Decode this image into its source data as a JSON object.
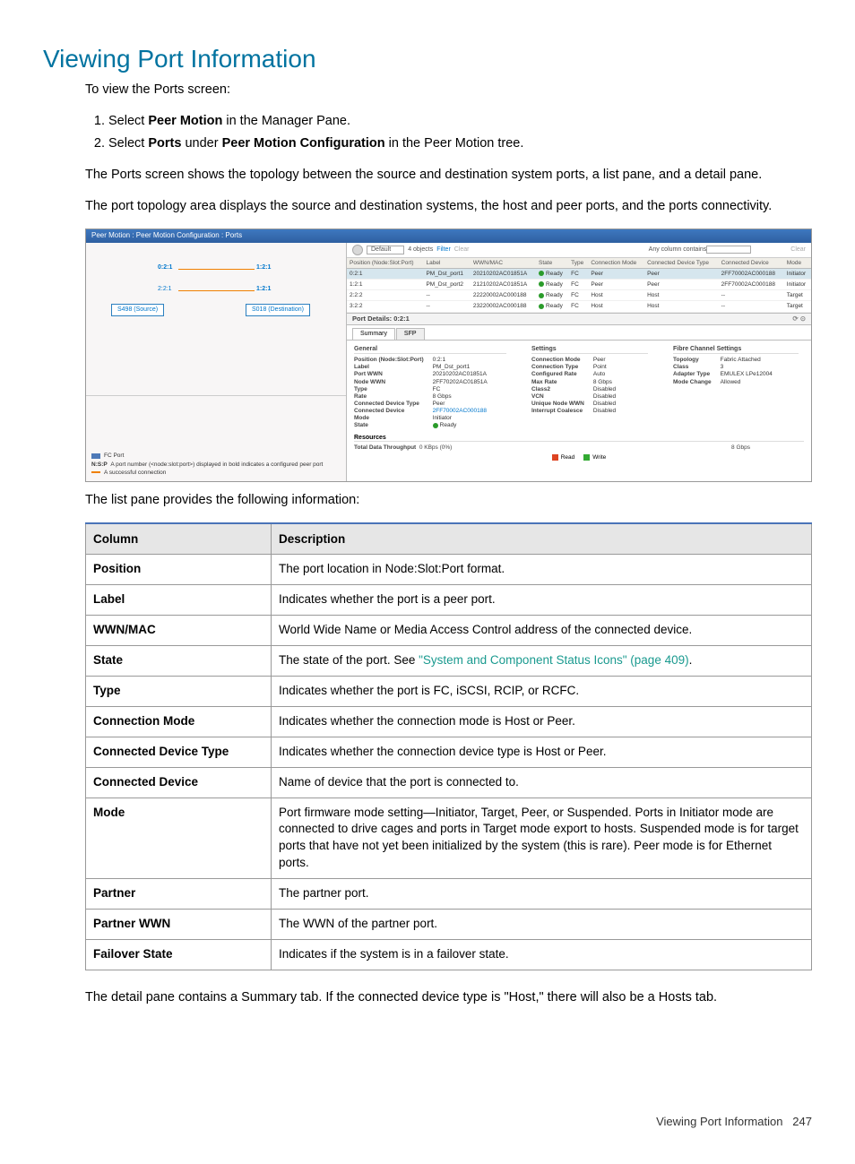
{
  "title": "Viewing Port Information",
  "intro": "To view the Ports screen:",
  "step1_a": "Select ",
  "step1_b": "Peer Motion",
  "step1_c": " in the Manager Pane.",
  "step2_a": "Select ",
  "step2_b": "Ports",
  "step2_c": " under ",
  "step2_d": "Peer Motion Configuration",
  "step2_e": " in the Peer Motion tree.",
  "para1": "The Ports screen shows the topology between the source and destination system ports, a list pane, and a detail pane.",
  "para2": "The port topology area displays the source and destination systems, the host and peer ports, and the ports connectivity.",
  "para3": "The list pane provides the following information:",
  "para4": "The detail pane contains a Summary tab. If the connected device type is \"Host,\" there will also be a Hosts tab.",
  "screenshot": {
    "title": "Peer Motion : Peer Motion Configuration : Ports",
    "topo": {
      "p1": "0:2:1",
      "p2": "1:2:1",
      "p3": "2:2:1",
      "p4": "1:2:1",
      "src": "S498 (Source)",
      "dst": "S018 (Destination)"
    },
    "legend": {
      "l1": "FC Port",
      "l2_a": "N:S:P",
      "l2_b": "A port number (<node:slot:port>) displayed in bold indicates a configured peer port",
      "l3": "A successful connection"
    },
    "toolbar": {
      "default": "Default",
      "objects": "4 objects",
      "filter": "Filter",
      "clear": "Clear",
      "any": "Any column contains",
      "clearbtn": "Clear"
    },
    "headers": [
      "Position (Node:Slot:Port)",
      "Label",
      "WWN/MAC",
      "State",
      "Type",
      "Connection Mode",
      "Connected Device Type",
      "Connected Device",
      "Mode"
    ],
    "rows": [
      {
        "pos": "0:2:1",
        "label": "PM_Dst_port1",
        "wwn": "20210202AC01851A",
        "state": "Ready",
        "type": "FC",
        "cm": "Peer",
        "cdt": "Peer",
        "cd": "2FF70002AC000188",
        "mode": "Initiator",
        "sel": true
      },
      {
        "pos": "1:2:1",
        "label": "PM_Dst_port2",
        "wwn": "21210202AC01851A",
        "state": "Ready",
        "type": "FC",
        "cm": "Peer",
        "cdt": "Peer",
        "cd": "2FF70002AC000188",
        "mode": "Initiator"
      },
      {
        "pos": "2:2:2",
        "label": "--",
        "wwn": "22220002AC000188",
        "state": "Ready",
        "type": "FC",
        "cm": "Host",
        "cdt": "Host",
        "cd": "--",
        "mode": "Target"
      },
      {
        "pos": "3:2:2",
        "label": "--",
        "wwn": "23220002AC000188",
        "state": "Ready",
        "type": "FC",
        "cm": "Host",
        "cdt": "Host",
        "cd": "--",
        "mode": "Target"
      }
    ],
    "detailTitle": "Port Details: 0:2:1",
    "tabs": {
      "summary": "Summary",
      "sfp": "SFP"
    },
    "detail": {
      "general": {
        "title": "General",
        "kv": [
          [
            "Position (Node:Slot:Port)",
            "0:2:1"
          ],
          [
            "Label",
            "PM_Dst_port1"
          ],
          [
            "Port WWN",
            "20210202AC01851A"
          ],
          [
            "Node WWN",
            "2FF70202AC01851A"
          ],
          [
            "Type",
            "FC"
          ],
          [
            "Rate",
            "8 Gbps"
          ],
          [
            "Connected Device Type",
            "Peer"
          ],
          [
            "Connected Device",
            "2FF70002AC000188"
          ],
          [
            "Mode",
            "Initiator"
          ],
          [
            "State",
            "Ready"
          ]
        ]
      },
      "settings": {
        "title": "Settings",
        "kv": [
          [
            "Connection Mode",
            "Peer"
          ],
          [
            "Connection Type",
            "Point"
          ],
          [
            "Configured Rate",
            "Auto"
          ],
          [
            "Max Rate",
            "8 Gbps"
          ],
          [
            "Class2",
            "Disabled"
          ],
          [
            "VCN",
            "Disabled"
          ],
          [
            "Unique Node WWN",
            "Disabled"
          ],
          [
            "Interrupt Coalesce",
            "Disabled"
          ]
        ]
      },
      "fc": {
        "title": "Fibre Channel Settings",
        "kv": [
          [
            "Topology",
            "Fabric Attached"
          ],
          [
            "Class",
            "3"
          ],
          [
            "Adapter Type",
            "EMULEX LPe12004"
          ],
          [
            "Mode Change",
            "Allowed"
          ]
        ]
      }
    },
    "resources": {
      "title": "Resources",
      "thr": "Total Data Throughput",
      "val": "0 KBps (0%)",
      "right": "8 Gbps",
      "read": "Read",
      "write": "Write"
    }
  },
  "table": {
    "h1": "Column",
    "h2": "Description",
    "rows": [
      {
        "c": "Position",
        "d": "The port location in Node:Slot:Port format."
      },
      {
        "c": "Label",
        "d": "Indicates whether the port is a peer port."
      },
      {
        "c": "WWN/MAC",
        "d": "World Wide Name or Media Access Control address of the connected device."
      },
      {
        "c": "State",
        "d_a": "The state of the port. See ",
        "link": "\"System and Component Status Icons\" (page 409)",
        "d_b": "."
      },
      {
        "c": "Type",
        "d": "Indicates whether the port is FC, iSCSI, RCIP, or RCFC."
      },
      {
        "c": "Connection Mode",
        "d": "Indicates whether the connection mode is Host or Peer."
      },
      {
        "c": "Connected Device Type",
        "d": "Indicates whether the connection device type is Host or Peer."
      },
      {
        "c": "Connected Device",
        "d": "Name of device that the port is connected to."
      },
      {
        "c": "Mode",
        "d": "Port firmware mode setting—Initiator, Target, Peer, or Suspended. Ports in Initiator mode are connected to drive cages and ports in Target mode export to hosts. Suspended mode is for target ports that have not yet been initialized by the system (this is rare). Peer mode is for Ethernet ports."
      },
      {
        "c": "Partner",
        "d": "The partner port."
      },
      {
        "c": "Partner WWN",
        "d": "The WWN of the partner port."
      },
      {
        "c": "Failover State",
        "d": "Indicates if the system is in a failover state."
      }
    ]
  },
  "footer_a": "Viewing Port Information",
  "footer_b": "247"
}
